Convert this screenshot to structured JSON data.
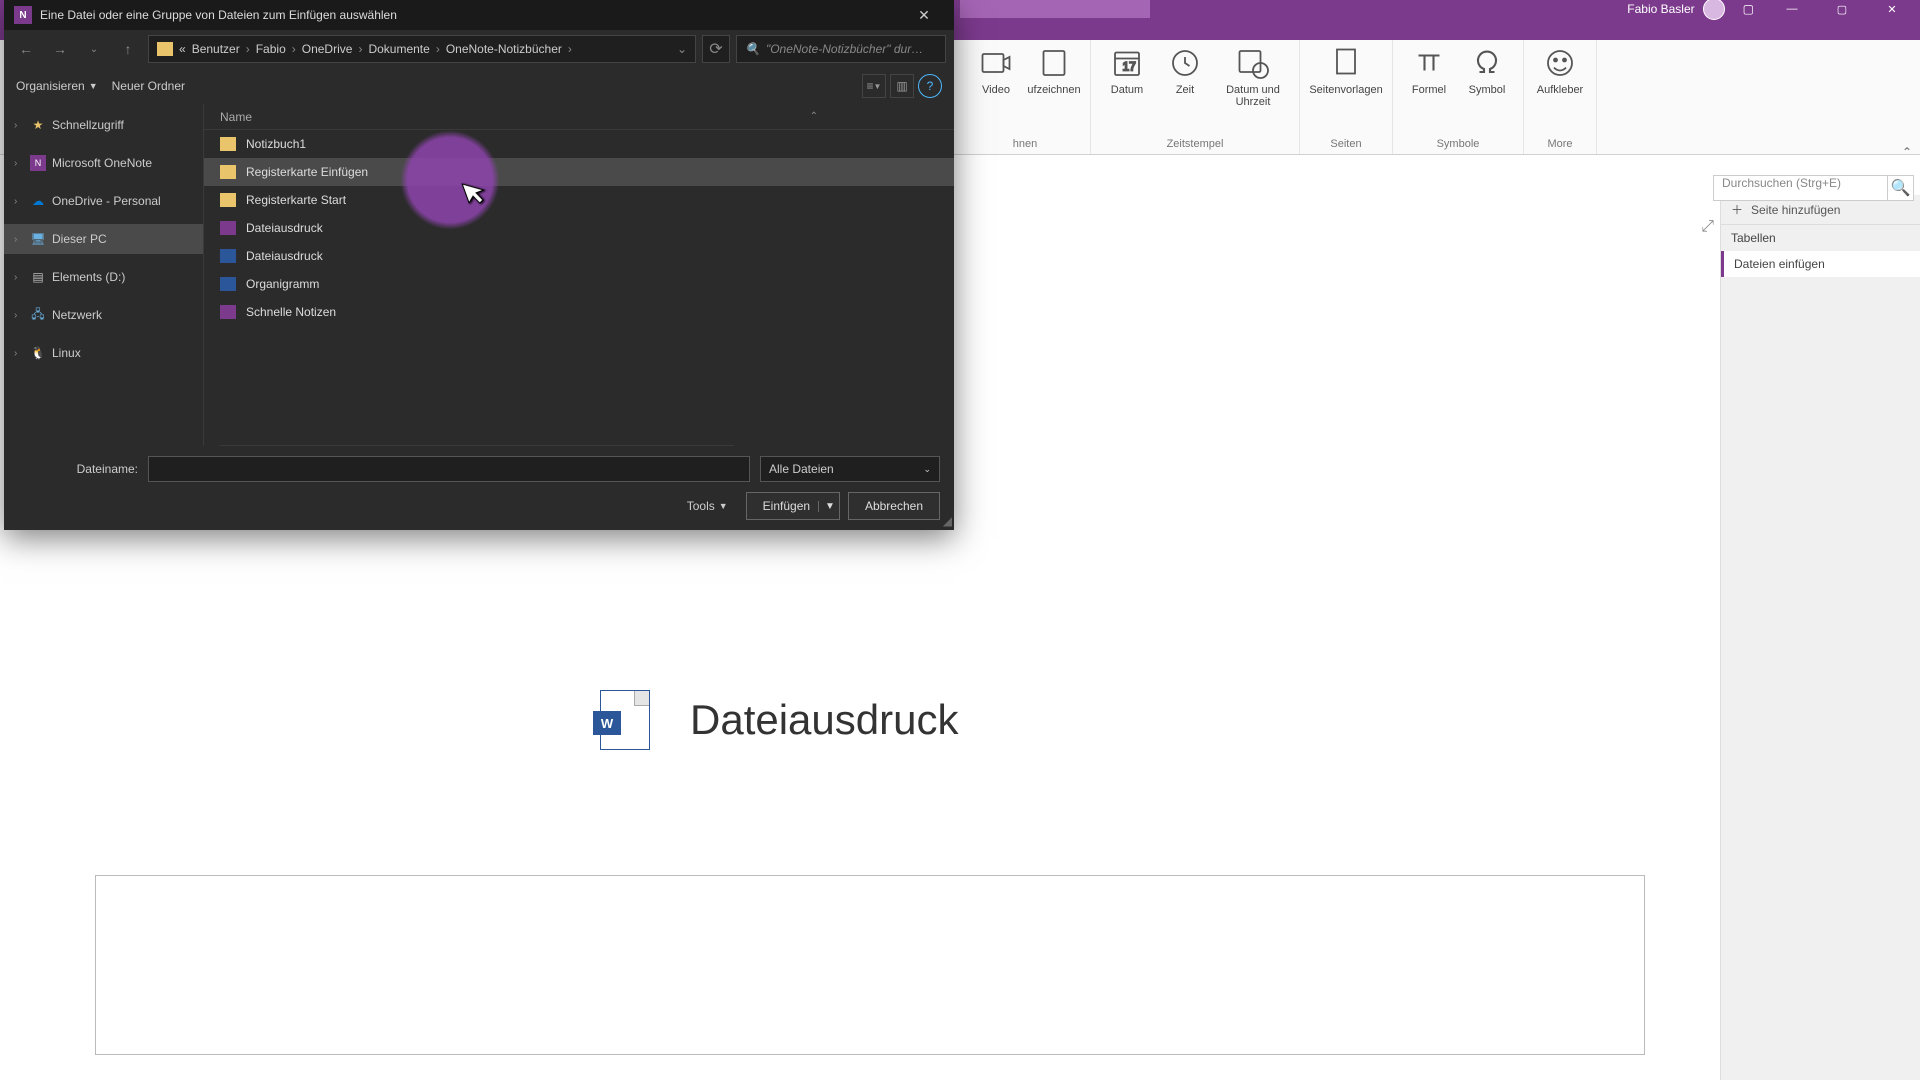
{
  "onenote": {
    "user_name": "Fabio Basler",
    "search_placeholder": "Durchsuchen (Strg+E)",
    "add_page": "Seite hinzufügen",
    "pages": [
      "Tabellen",
      "Dateien einfügen"
    ],
    "doc_title": "Dateiausdruck",
    "ribbon": {
      "video": "Video",
      "aufzeichnen": "ufzeichnen",
      "hnen": "hnen",
      "datum": "Datum",
      "zeit": "Zeit",
      "datum_uhrzeit": "Datum und\nUhrzeit",
      "group_zeitstempel": "Zeitstempel",
      "seitenvorlagen": "Seitenvorlagen",
      "group_seiten": "Seiten",
      "formel": "Formel",
      "symbol": "Symbol",
      "group_symbole": "Symbole",
      "aufkleber": "Aufkleber",
      "group_more": "More"
    }
  },
  "dialog": {
    "title": "Eine Datei oder eine Gruppe von Dateien zum Einfügen auswählen",
    "breadcrumb": [
      "Benutzer",
      "Fabio",
      "OneDrive",
      "Dokumente",
      "OneNote-Notizbücher"
    ],
    "search_placeholder": "\"OneNote-Notizbücher\" dur…",
    "organize": "Organisieren",
    "new_folder": "Neuer Ordner",
    "col_name": "Name",
    "tree": {
      "quick": "Schnellzugriff",
      "onenote": "Microsoft OneNote",
      "onedrive": "OneDrive - Personal",
      "thispc": "Dieser PC",
      "elements": "Elements (D:)",
      "network": "Netzwerk",
      "linux": "Linux"
    },
    "files": [
      {
        "name": "Notizbuch1",
        "type": "folder"
      },
      {
        "name": "Registerkarte Einfügen",
        "type": "folder",
        "selected": true
      },
      {
        "name": "Registerkarte Start",
        "type": "folder"
      },
      {
        "name": "Dateiausdruck",
        "type": "one"
      },
      {
        "name": "Dateiausdruck",
        "type": "doc"
      },
      {
        "name": "Organigramm",
        "type": "doc"
      },
      {
        "name": "Schnelle Notizen",
        "type": "one"
      }
    ],
    "filename_label": "Dateiname:",
    "file_types": "Alle Dateien",
    "tools": "Tools",
    "insert": "Einfügen",
    "cancel": "Abbrechen"
  }
}
